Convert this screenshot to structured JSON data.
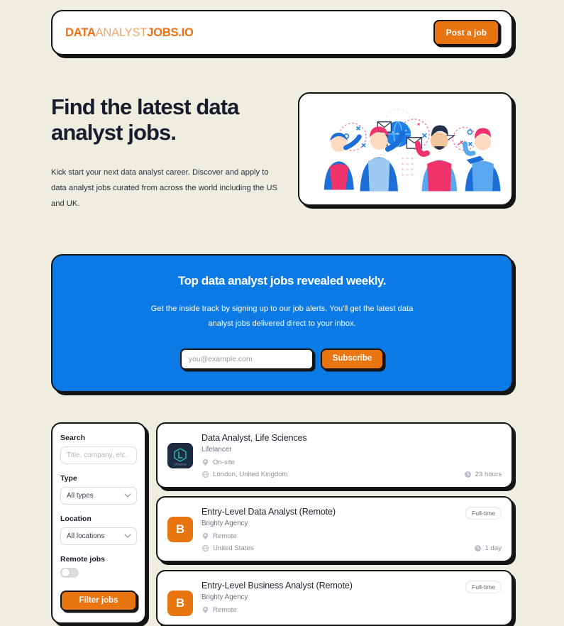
{
  "theme": {
    "page_bg": "#efece0",
    "accent_orange": "#e87511",
    "accent_blue": "#0b7ae5",
    "ink": "#141414",
    "logo_bold": "#ed7014",
    "logo_light": "#f0a86a"
  },
  "header": {
    "logo_part1": "DATA",
    "logo_part2": "ANALYST",
    "logo_part3": "JOBS.IO",
    "post_job_label": "Post a job"
  },
  "hero": {
    "title": "Find the latest data analyst jobs.",
    "subtitle": "Kick start your next data analyst career. Discover and apply to data analyst jobs curated from across the world including the US and UK.",
    "illustration_name": "people-data-collaboration-illustration"
  },
  "newsletter": {
    "title": "Top data analyst jobs revealed weekly.",
    "subtitle": "Get the inside track by signing up to our job alerts. You'll get the latest data analyst jobs delivered direct to your inbox.",
    "email_placeholder": "you@example.com",
    "email_value": "",
    "subscribe_label": "Subscribe"
  },
  "filters": {
    "search_label": "Search",
    "search_placeholder": "Title, company, etc.",
    "search_value": "",
    "type_label": "Type",
    "type_value": "All types",
    "type_options": [
      "All types"
    ],
    "location_label": "Location",
    "location_value": "All locations",
    "location_options": [
      "All locations"
    ],
    "remote_label": "Remote jobs",
    "remote_on": false,
    "filter_button_label": "Filter jobs"
  },
  "jobs": [
    {
      "title": "Data Analyst, Life Sciences",
      "company": "Lifelancer",
      "work_mode": "On-site",
      "location": "London, United Kingdom",
      "posted": "23 hours",
      "badge": "",
      "logo_type": "image",
      "logo_letter": "",
      "logo_bg": "#1c2b3f",
      "logo_text": "Lifelancer"
    },
    {
      "title": "Entry-Level Data Analyst (Remote)",
      "company": "Brighty Agency",
      "work_mode": "Remote",
      "location": "United States",
      "posted": "1 day",
      "badge": "Full-time",
      "logo_type": "letter",
      "logo_letter": "B",
      "logo_bg": "#e87511",
      "logo_text": ""
    },
    {
      "title": "Entry-Level Business Analyst (Remote)",
      "company": "Brighty Agency",
      "work_mode": "Remote",
      "location": "",
      "posted": "",
      "badge": "Full-time",
      "logo_type": "letter",
      "logo_letter": "B",
      "logo_bg": "#e87511",
      "logo_text": ""
    }
  ]
}
